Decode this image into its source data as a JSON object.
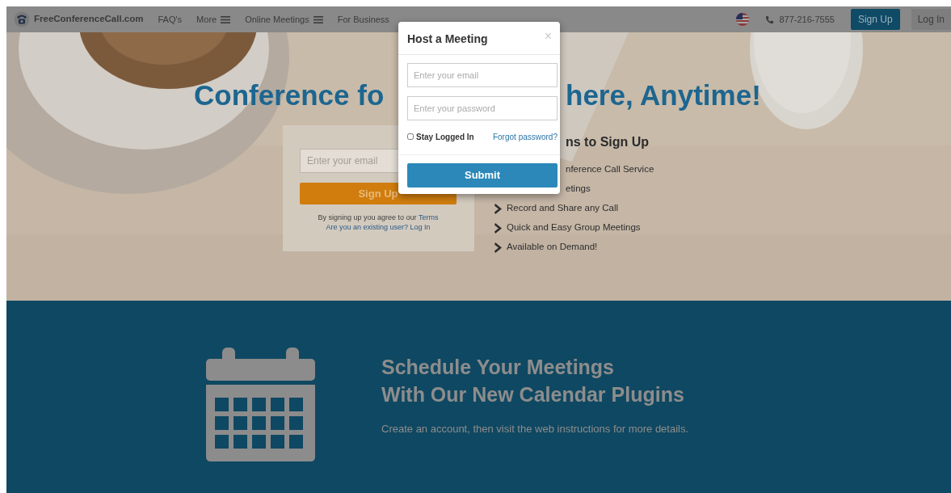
{
  "navbar": {
    "brand": "FreeConferenceCall.com",
    "links": [
      {
        "label": "FAQ's",
        "menu": false
      },
      {
        "label": "More",
        "menu": true
      },
      {
        "label": "Online Meetings",
        "menu": true
      },
      {
        "label": "For Business",
        "menu": false
      }
    ],
    "phone": "877-216-7555",
    "buttons": [
      {
        "label": "Sign Up",
        "kind": "primary"
      },
      {
        "label": "Log In",
        "kind": "secondary"
      }
    ]
  },
  "hero": {
    "headline_left": "Conference fo",
    "headline_right": "here, Anytime!",
    "signup": {
      "email_placeholder": "Enter your email",
      "button": "Sign Up",
      "terms_text": "By signing up you agree to our",
      "terms_link": "Terms",
      "existing_link": "Are you an existing user? Log In"
    },
    "reasons": {
      "heading": "ns to Sign Up",
      "items": [
        {
          "text": "nference Call Service",
          "kind": "covered"
        },
        {
          "text": "etings",
          "kind": "covered"
        },
        {
          "text": "Record and Share any Call",
          "kind": "bullet"
        },
        {
          "text": "Quick and Easy Group Meetings",
          "kind": "bullet"
        },
        {
          "text": "Available on Demand!",
          "kind": "bullet"
        }
      ]
    }
  },
  "modal": {
    "title": "Host a Meeting",
    "close": "×",
    "email_placeholder": "Enter your email",
    "password_placeholder": "Enter your password",
    "stay_logged_in": {
      "label": "Stay Logged In",
      "checked": false
    },
    "forgot": "Forgot password?",
    "submit": "Submit"
  },
  "promo": {
    "heading_lines": [
      "Schedule Your Meetings",
      "With Our New Calendar Plugins"
    ],
    "text": "Create an account, then visit the web instructions for more details."
  }
}
